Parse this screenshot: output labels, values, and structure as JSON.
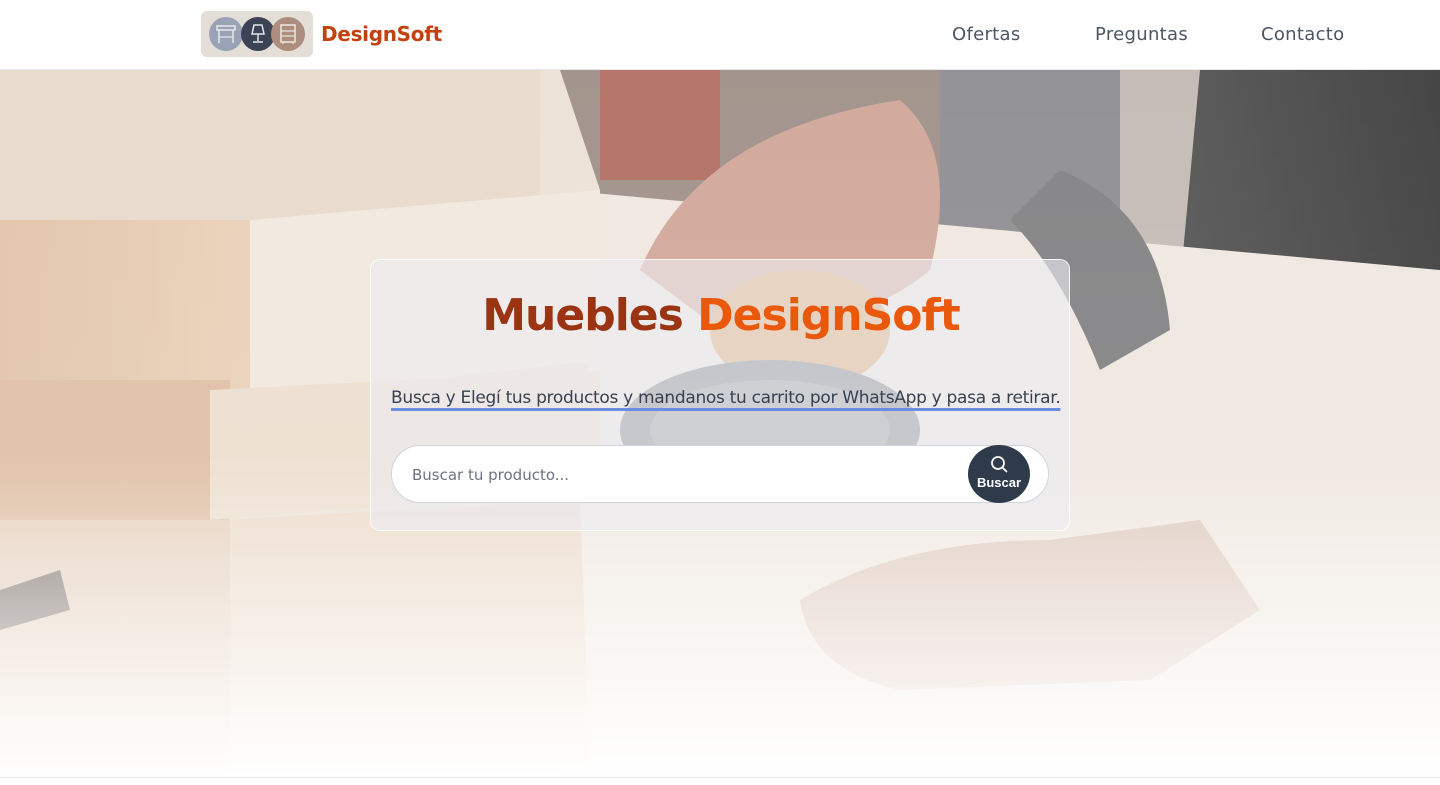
{
  "header": {
    "brand": "DesignSoft",
    "nav": {
      "ofertas": "Ofertas",
      "preguntas": "Preguntas",
      "contacto": "Contacto"
    }
  },
  "hero": {
    "title_part1": "Muebles ",
    "title_part2": "DesignSoft",
    "tagline": "Busca y Elegí tus productos y mandanos tu carrito por WhatsApp y pasa a retirar.",
    "search": {
      "placeholder": "Buscar tu producto...",
      "button_label": "Buscar",
      "button_icon": "search-icon"
    }
  },
  "colors": {
    "brand_dark": "#9a3412",
    "brand_accent": "#ea580c",
    "button_dark": "#2f3a4a",
    "underline": "#6b8de0"
  }
}
